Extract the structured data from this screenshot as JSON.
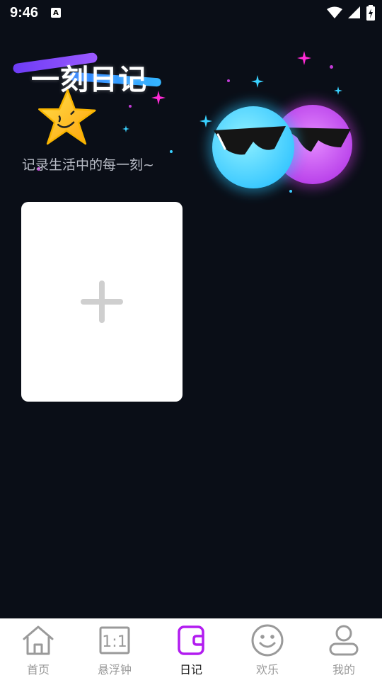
{
  "status_bar": {
    "time": "9:46",
    "notification_glyph": "A"
  },
  "header": {
    "title": "一刻日记",
    "subtitle": "记录生活中的每一刻~"
  },
  "add_card": {
    "icon": "plus-icon"
  },
  "tabbar": {
    "tabs": [
      {
        "label": "首页",
        "icon": "home-icon",
        "active": false
      },
      {
        "label": "悬浮钟",
        "icon": "floating-clock-icon",
        "active": false
      },
      {
        "label": "日记",
        "icon": "diary-icon",
        "active": true
      },
      {
        "label": "欢乐",
        "icon": "smile-icon",
        "active": false
      },
      {
        "label": "我的",
        "icon": "profile-icon",
        "active": false
      }
    ]
  },
  "colors": {
    "background": "#0a0e17",
    "accent_active": "#b21cf0",
    "tab_inactive": "#9a9a9a",
    "card": "#ffffff"
  }
}
